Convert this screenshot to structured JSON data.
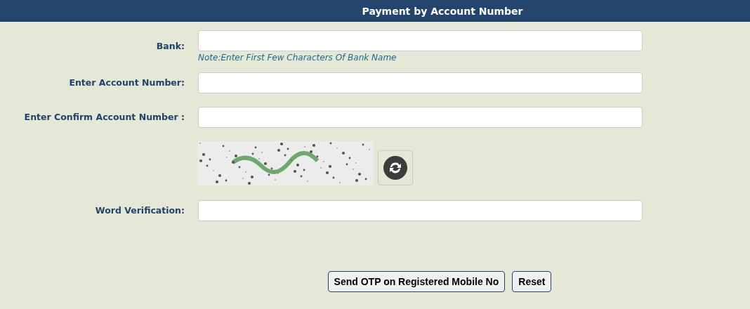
{
  "header": {
    "title": "Payment by Account Number"
  },
  "fields": [
    {
      "kind": "text",
      "label": "Bank:",
      "note": "Note:Enter First Few Characters Of Bank Name"
    },
    {
      "kind": "text",
      "label": "Enter Account Number:"
    },
    {
      "kind": "text",
      "label": "Enter Confirm Account Number :"
    },
    {
      "kind": "captcha"
    },
    {
      "kind": "text",
      "label": "Word Verification:"
    }
  ],
  "buttons": [
    "Send OTP on Registered Mobile No",
    "Reset"
  ]
}
